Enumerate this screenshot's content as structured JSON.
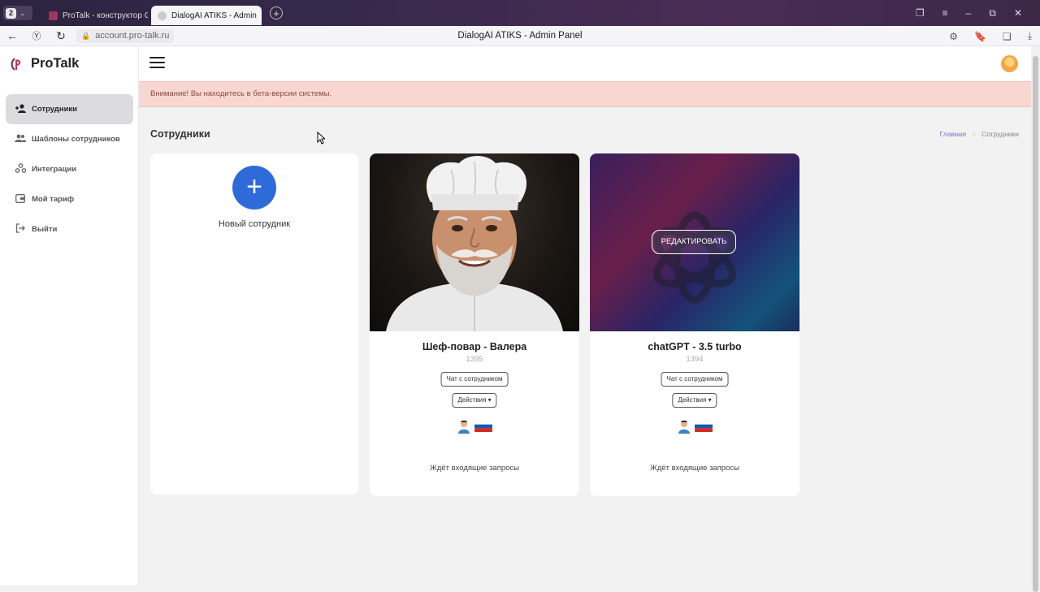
{
  "browser": {
    "tab_count": "2",
    "tabs": [
      {
        "label": "ProTalk - конструктор GPT"
      },
      {
        "label": "DialogAI ATIKS - Admin"
      }
    ],
    "url": "account.pro-talk.ru",
    "window_title": "DialogAI ATIKS - Admin Panel"
  },
  "sidebar": {
    "brand": "ProTalk",
    "items": [
      {
        "label": "Сотрудники",
        "icon": "user-plus-icon",
        "active": true
      },
      {
        "label": "Шаблоны сотрудников",
        "icon": "users-icon",
        "active": false
      },
      {
        "label": "Интеграции",
        "icon": "integrations-icon",
        "active": false
      },
      {
        "label": "Мой тариф",
        "icon": "wallet-icon",
        "active": false
      },
      {
        "label": "Выйти",
        "icon": "logout-icon",
        "active": false
      }
    ]
  },
  "alert": {
    "text": "Внимание! Вы находитесь в бета-версии системы."
  },
  "page": {
    "title": "Сотрудники",
    "breadcrumb": {
      "home": "Главная",
      "separator": ">",
      "current": "Сотрудники"
    }
  },
  "new_card": {
    "label": "Новый сотрудник"
  },
  "employees": [
    {
      "name": "Шеф-повар - Валера",
      "id": "1395",
      "chat_label": "Чат с сотрудником",
      "actions_label": "Действия",
      "status": "Ждёт входящие запросы"
    },
    {
      "name": "chatGPT - 3.5 turbo",
      "id": "1394",
      "chat_label": "Чат с сотрудником",
      "actions_label": "Действия",
      "status": "Ждёт входящие запросы",
      "edit_label": "РЕДАКТИРОВАТЬ"
    }
  ],
  "colors": {
    "accent": "#2f6bd8",
    "alert_bg": "#f8d7d2",
    "alert_text": "#8a4a44"
  }
}
